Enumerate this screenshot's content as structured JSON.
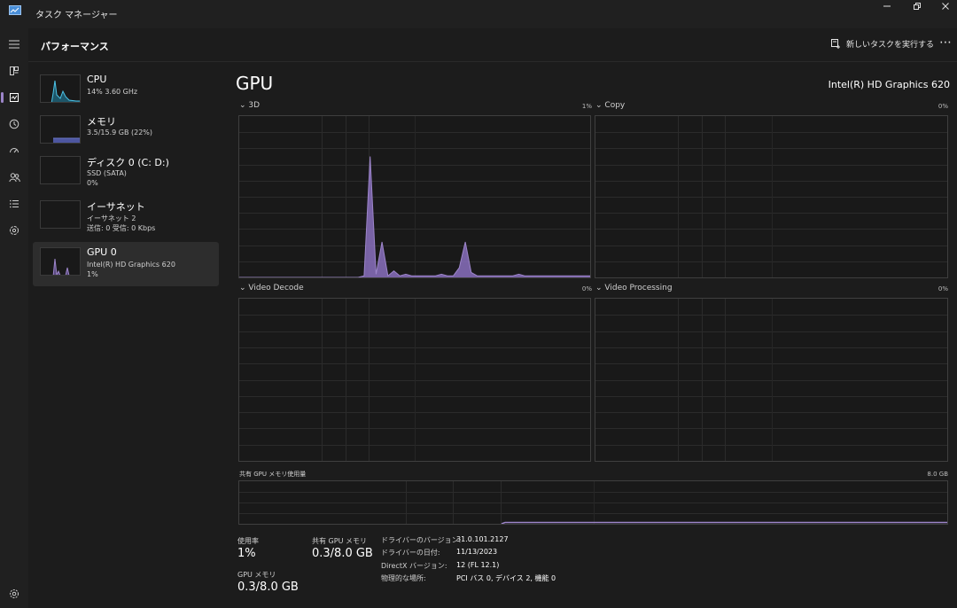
{
  "window": {
    "title": "タスク マネージャー",
    "minimize": "—",
    "maximize": "□",
    "close": "✕"
  },
  "header": {
    "title": "パフォーマンス",
    "run_task": "新しいタスクを実行する",
    "more": "⋯"
  },
  "rail": {
    "items": [
      "hamburger-icon",
      "processes-icon",
      "performance-icon",
      "history-icon",
      "startup-icon",
      "users-icon",
      "details-icon",
      "services-icon"
    ],
    "settings": "gear-icon"
  },
  "sidebar": {
    "items": [
      {
        "name": "CPU",
        "sub": "14%  3.60 GHz",
        "sub2": ""
      },
      {
        "name": "メモリ",
        "sub": "3.5/15.9 GB (22%)",
        "sub2": ""
      },
      {
        "name": "ディスク 0 (C: D:)",
        "sub": "SSD (SATA)",
        "sub2": "0%"
      },
      {
        "name": "イーサネット",
        "sub": "イーサネット 2",
        "sub2": "送信: 0  受信: 0 Kbps"
      },
      {
        "name": "GPU 0",
        "sub": "Intel(R) HD Graphics 620",
        "sub2": "1%"
      }
    ]
  },
  "colors": {
    "cpu": "#4cc2e6",
    "memory": "#6b76c9",
    "disk": "#58a862",
    "ethernet": "#c07f5a",
    "gpu": "#9c85c9",
    "gpu_fill": "#8a70be"
  },
  "main": {
    "title": "GPU",
    "model": "Intel(R) HD Graphics 620",
    "engines": [
      {
        "label": "3D",
        "pct": "1%"
      },
      {
        "label": "Copy",
        "pct": "0%"
      },
      {
        "label": "Video Decode",
        "pct": "0%"
      },
      {
        "label": "Video Processing",
        "pct": "0%"
      }
    ],
    "shared_memory": {
      "label": "共有 GPU メモリ使用量",
      "max": "8.0 GB"
    },
    "stats": {
      "utilization_label": "使用率",
      "utilization_value": "1%",
      "shared_label": "共有 GPU メモリ",
      "shared_value": "0.3/8.0 GB",
      "gpu_mem_label": "GPU メモリ",
      "gpu_mem_value": "0.3/8.0 GB"
    },
    "info": [
      {
        "k": "ドライバーのバージョン:",
        "v": "31.0.101.2127"
      },
      {
        "k": "ドライバーの日付:",
        "v": "11/13/2023"
      },
      {
        "k": "DirectX バージョン:",
        "v": "12 (FL 12.1)"
      },
      {
        "k": "物理的な場所:",
        "v": "PCI バス 0, デバイス 2, 機能 0"
      }
    ]
  },
  "chart_data": [
    {
      "type": "area",
      "name": "3D",
      "ylim": [
        0,
        100
      ],
      "x": [
        0,
        1,
        2,
        3,
        4,
        5,
        6,
        7,
        8,
        9,
        10,
        11,
        12,
        13,
        14,
        15,
        16,
        17,
        18,
        19,
        20,
        21,
        22,
        23,
        24,
        25,
        26,
        27,
        28,
        29,
        30,
        31,
        32,
        33,
        34,
        35,
        36,
        37,
        38,
        39,
        40,
        41,
        42,
        43,
        44,
        45,
        46,
        47,
        48,
        49,
        50,
        51,
        52,
        53,
        54,
        55,
        56,
        57,
        58,
        59
      ],
      "values": [
        0,
        0,
        0,
        0,
        0,
        0,
        0,
        0,
        0,
        0,
        0,
        0,
        0,
        0,
        0,
        0,
        0,
        0,
        0,
        0,
        0,
        1,
        75,
        2,
        22,
        1,
        4,
        1,
        2,
        1,
        1,
        1,
        1,
        1,
        2,
        1,
        1,
        6,
        22,
        3,
        1,
        1,
        1,
        1,
        1,
        1,
        1,
        2,
        1,
        1,
        1,
        1,
        1,
        1,
        1,
        1,
        1,
        1,
        1,
        1
      ]
    }
  ]
}
